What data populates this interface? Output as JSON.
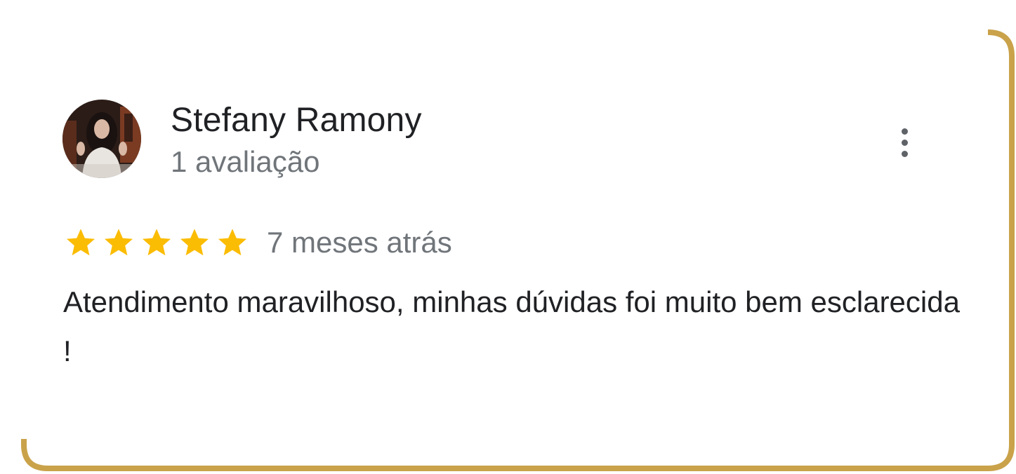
{
  "review": {
    "reviewer_name": "Stefany Ramony",
    "review_count": "1 avaliação",
    "rating": 5,
    "rating_max": 5,
    "date": "7 meses atrás",
    "text": "Atendimento maravilhoso, minhas dúvidas foi muito bem esclarecida !"
  },
  "icons": {
    "more": "more-vert-icon",
    "star": "star-icon",
    "avatar": "avatar"
  },
  "colors": {
    "frame": "#c9a24a",
    "star": "#fbbc04",
    "name": "#202124",
    "secondary": "#70757a"
  }
}
